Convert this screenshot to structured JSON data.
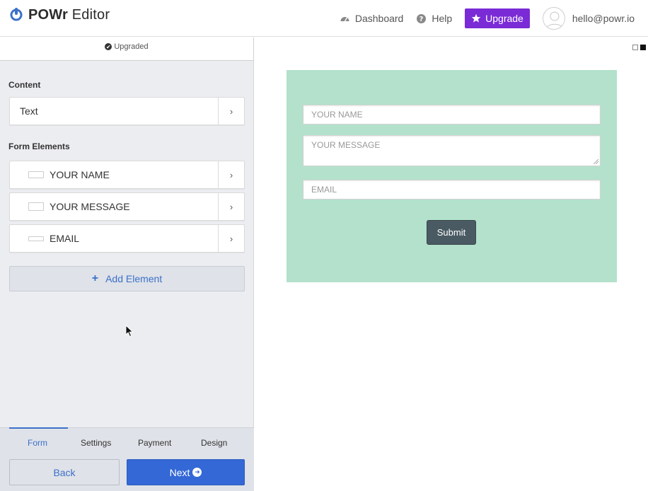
{
  "header": {
    "app_name_bold": "POWr",
    "app_name_rest": " Editor",
    "nav": {
      "dashboard": "Dashboard",
      "help": "Help",
      "upgrade": "Upgrade",
      "email": "hello@powr.io"
    }
  },
  "left_panel": {
    "upgraded_label": "Upgraded",
    "content_section": {
      "title": "Content",
      "items": [
        {
          "label": "Text",
          "chevron": "›"
        }
      ]
    },
    "form_elements_section": {
      "title": "Form Elements",
      "items": [
        {
          "label": "YOUR NAME",
          "chevron": "›",
          "icon": "text-field-icon"
        },
        {
          "label": "YOUR MESSAGE",
          "chevron": "›",
          "icon": "textarea-field-icon"
        },
        {
          "label": "EMAIL",
          "chevron": "›",
          "icon": "email-field-icon"
        }
      ]
    },
    "add_element": {
      "icon": "+",
      "label": "Add Element"
    },
    "tabs": [
      {
        "label": "Form",
        "active": true
      },
      {
        "label": "Settings",
        "active": false
      },
      {
        "label": "Payment",
        "active": false
      },
      {
        "label": "Design",
        "active": false
      }
    ],
    "back_label": "Back",
    "next_label": "Next"
  },
  "preview": {
    "fields": {
      "name_placeholder": "YOUR NAME",
      "message_placeholder": "YOUR MESSAGE",
      "email_placeholder": "EMAIL"
    },
    "submit_label": "Submit"
  },
  "colors": {
    "upgrade_purple": "#7a2bd6",
    "accent_blue": "#3468d6",
    "form_bg": "#b3e1cc",
    "submit_bg": "#4a5a62"
  }
}
